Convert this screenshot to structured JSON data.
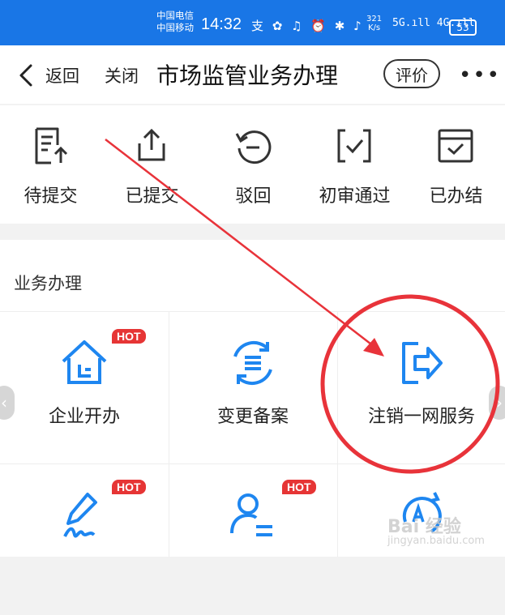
{
  "statusbar": {
    "carrier1": "中国电信",
    "carrier2": "中国移动",
    "time": "14:32",
    "icons": "支 ✿ ♫ ⏰ ✱ ♪",
    "speed_value": "321",
    "speed_unit": "K/s",
    "signal": "5G.ıll 4G.ıll",
    "battery": "53"
  },
  "nav": {
    "back_label": "返回",
    "close_label": "关闭",
    "title": "市场监管业务办理",
    "rate_label": "评价",
    "more": "•••"
  },
  "status_items": [
    {
      "label": "待提交",
      "icon": "document-upload-icon"
    },
    {
      "label": "已提交",
      "icon": "share-upload-icon"
    },
    {
      "label": "驳回",
      "icon": "undo-circle-icon"
    },
    {
      "label": "初审通过",
      "icon": "check-bracket-icon"
    },
    {
      "label": "已办结",
      "icon": "calendar-check-icon"
    }
  ],
  "business": {
    "section_title": "业务办理",
    "items": [
      {
        "label": "企业开办",
        "icon": "home-icon",
        "badge": "HOT"
      },
      {
        "label": "变更备案",
        "icon": "refresh-list-icon",
        "badge": ""
      },
      {
        "label": "注销一网服务",
        "icon": "logout-icon",
        "badge": ""
      },
      {
        "label": "",
        "icon": "signature-icon",
        "badge": "HOT"
      },
      {
        "label": "",
        "icon": "user-list-icon",
        "badge": "HOT"
      },
      {
        "label": "",
        "icon": "rotate-text-icon",
        "badge": ""
      }
    ]
  },
  "watermark": {
    "line1": "Bai 经验",
    "line2": "jingyan.baidu.com"
  },
  "colors": {
    "accent": "#1976e6",
    "hot": "#e63535",
    "annotation": "#e8333a"
  }
}
